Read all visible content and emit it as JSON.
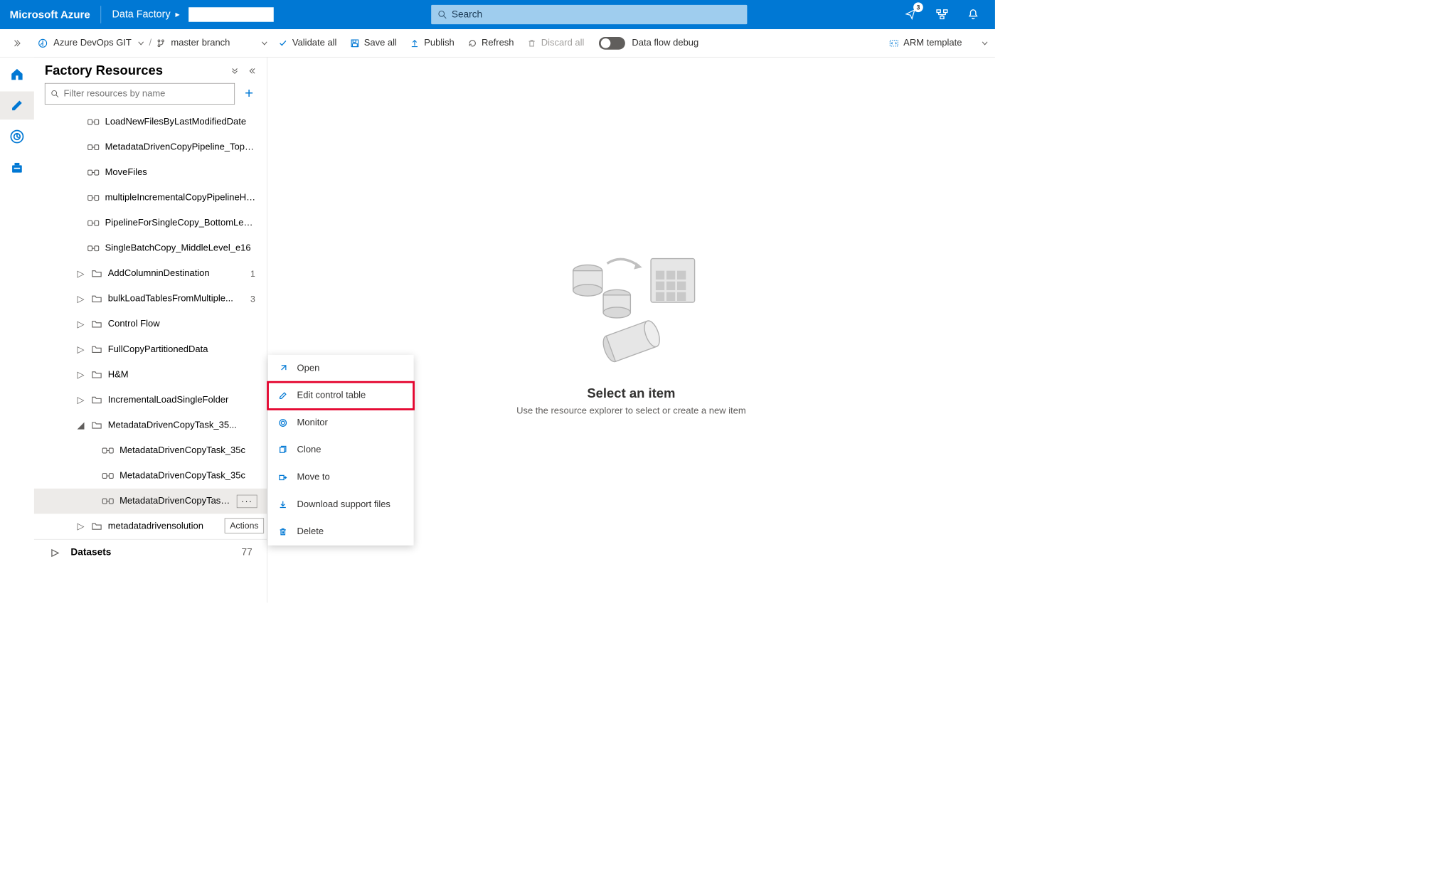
{
  "header": {
    "brand": "Microsoft Azure",
    "service": "Data Factory",
    "search_placeholder": "Search",
    "notification_badge": "3"
  },
  "toolbar": {
    "git": "Azure DevOps GIT",
    "branch": "master branch",
    "validate": "Validate all",
    "save": "Save all",
    "publish": "Publish",
    "refresh": "Refresh",
    "discard": "Discard all",
    "debug": "Data flow debug",
    "arm": "ARM template"
  },
  "resources": {
    "title": "Factory Resources",
    "filter_placeholder": "Filter resources by name",
    "pipelines": [
      "LoadNewFilesByLastModifiedDate",
      "MetadataDrivenCopyPipeline_TopLe...",
      "MoveFiles",
      "multipleIncrementalCopyPipelineHy...",
      "PipelineForSingleCopy_BottomLevel...",
      "SingleBatchCopy_MiddleLevel_e16"
    ],
    "folders": [
      {
        "name": "AddColumninDestination",
        "count": "1"
      },
      {
        "name": "bulkLoadTablesFromMultiple...",
        "count": "3"
      },
      {
        "name": "Control Flow",
        "count": ""
      },
      {
        "name": "FullCopyPartitionedData",
        "count": ""
      },
      {
        "name": "H&M",
        "count": ""
      },
      {
        "name": "IncrementalLoadSingleFolder",
        "count": ""
      }
    ],
    "open_folder": {
      "name": "MetadataDrivenCopyTask_35..."
    },
    "open_children": [
      "MetadataDrivenCopyTask_35c",
      "MetadataDrivenCopyTask_35c",
      "MetadataDrivenCopyTask_3..."
    ],
    "last_folder": {
      "name": "metadatadrivensolution",
      "count": ""
    },
    "actions_tooltip": "Actions",
    "datasets": {
      "name": "Datasets",
      "count": "77"
    }
  },
  "canvas": {
    "title": "Select an item",
    "subtitle": "Use the resource explorer to select or create a new item"
  },
  "context_menu": {
    "open": "Open",
    "edit": "Edit control table",
    "monitor": "Monitor",
    "clone": "Clone",
    "move": "Move to",
    "download": "Download support files",
    "delete": "Delete"
  }
}
